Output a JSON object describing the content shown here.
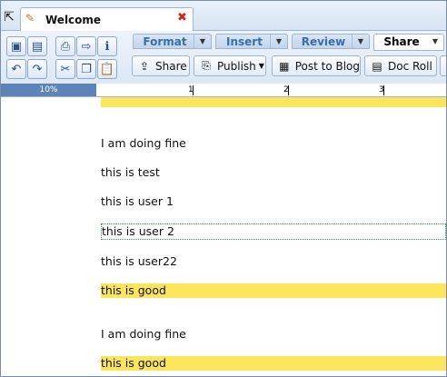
{
  "window": {
    "doc_tab_title": "Welcome"
  },
  "toolbar": {
    "tabs": [
      {
        "label": "Format"
      },
      {
        "label": "Insert"
      },
      {
        "label": "Review"
      },
      {
        "label": "Share"
      }
    ],
    "buttons": [
      {
        "label": "Share",
        "icon": "share-icon"
      },
      {
        "label": "Publish",
        "icon": "publish-icon"
      },
      {
        "label": "Post to Blog",
        "icon": "blog-icon"
      },
      {
        "label": "Doc Roll",
        "icon": "doc-roll-icon"
      }
    ]
  },
  "ruler": {
    "zoom": "10%",
    "marks": [
      "1",
      "2",
      "3"
    ]
  },
  "document": {
    "paragraphs": [
      {
        "text": "I am doing fine",
        "highlight": false
      },
      {
        "text": "this is test",
        "highlight": false
      },
      {
        "text": "this is user 1",
        "highlight": false
      },
      {
        "text": "this is user 2",
        "highlight": false,
        "selected": true
      },
      {
        "text": "this is user22",
        "highlight": false
      },
      {
        "text": "this is good",
        "highlight": true
      },
      {
        "text": "I am doing fine",
        "highlight": false
      },
      {
        "text": "this is good",
        "highlight": true
      }
    ]
  },
  "colors": {
    "highlight": "#fae55d",
    "accent": "#3a6ea9",
    "ruler_zoom": "#5d83b7"
  }
}
